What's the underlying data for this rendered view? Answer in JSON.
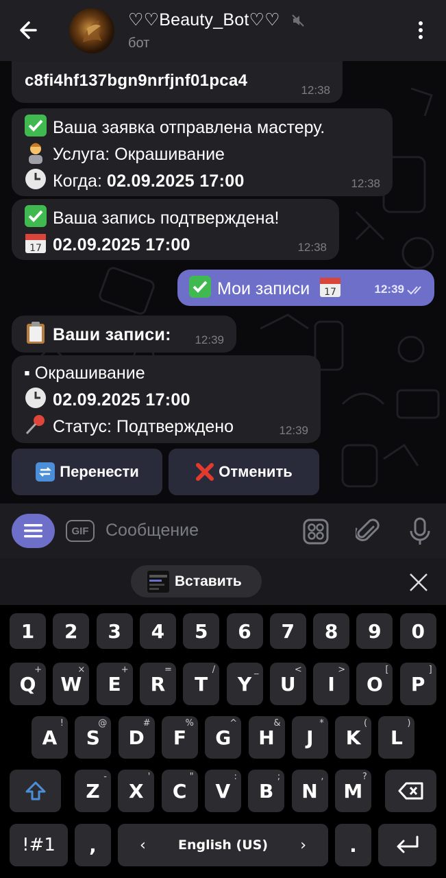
{
  "header": {
    "title": "♡♡Beauty_Bot♡♡",
    "subtitle": "бот"
  },
  "messages": {
    "m0": {
      "line1": "c8fi4hf137bgn9nrfjnf01pca4",
      "time": "12:38"
    },
    "m1": {
      "line1": "Ваша заявка отправлена мастеру.",
      "line2_label": "Услуга: Окрашивание",
      "line3_label": "Когда: ",
      "line3_value": "02.09.2025 17:00",
      "time": "12:38"
    },
    "m2": {
      "line1": "Ваша запись подтверждена!",
      "line2_value": "02.09.2025 17:00",
      "time": "12:38"
    },
    "m3": {
      "text": "Мои записи",
      "time": "12:39"
    },
    "m4": {
      "text": "Ваши записи:",
      "time": "12:39"
    },
    "m5": {
      "line1": "▪ Окрашивание",
      "line2_value": "02.09.2025 17:00",
      "line3": "Статус: Подтверждено",
      "time": "12:39"
    }
  },
  "inline_buttons": {
    "reschedule": "Перенести",
    "cancel": "Отменить"
  },
  "input": {
    "placeholder": "Сообщение",
    "gif": "GIF"
  },
  "clipboard": {
    "paste": "Вставить"
  },
  "keyboard": {
    "numbers": [
      "1",
      "2",
      "3",
      "4",
      "5",
      "6",
      "7",
      "8",
      "9",
      "0"
    ],
    "row1": [
      "Q",
      "W",
      "E",
      "R",
      "T",
      "Y",
      "U",
      "I",
      "O",
      "P"
    ],
    "row1_hints": [
      "+",
      "×",
      "+",
      "=",
      "/",
      "_",
      "<",
      ">",
      "[",
      "]"
    ],
    "row2": [
      "A",
      "S",
      "D",
      "F",
      "G",
      "H",
      "J",
      "K",
      "L"
    ],
    "row2_hints": [
      "!",
      "@",
      "#",
      "%",
      "^",
      "&",
      "*",
      "(",
      ")"
    ],
    "row3": [
      "Z",
      "X",
      "C",
      "V",
      "B",
      "N",
      "M"
    ],
    "row3_hints": [
      "-",
      "'",
      "\"",
      ":",
      ";",
      ",",
      "?"
    ],
    "symbols": "!#1",
    "comma": ",",
    "space": "English (US)",
    "period": "."
  },
  "colors": {
    "accent": "#6d6fc8",
    "bubble_in": "#212126",
    "header_bg": "#1f1f24",
    "key_bg": "#2c2c30"
  }
}
